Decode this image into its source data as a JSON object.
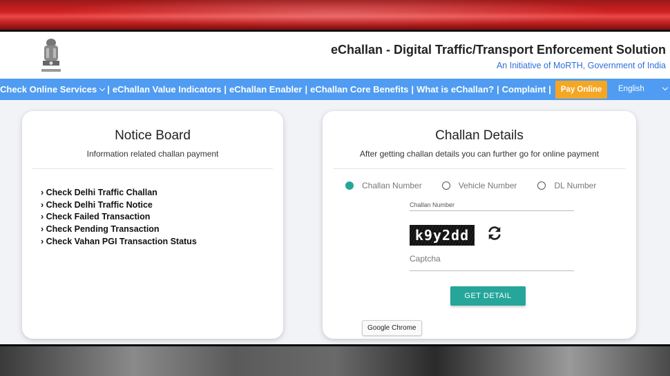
{
  "header": {
    "title": "eChallan - Digital Traffic/Transport Enforcement Solution",
    "subtitle": "An Initiative of MoRTH, Government of India"
  },
  "nav": {
    "check_online": "Check Online Services",
    "items": [
      "eChallan Value Indicators",
      "eChallan Enabler",
      "eChallan Core Benefits",
      "What is eChallan?",
      "Complaint"
    ],
    "pay_online": "Pay Online",
    "language": "English"
  },
  "notice_board": {
    "title": "Notice Board",
    "subtitle": "Information related challan payment",
    "links": [
      "Check Delhi Traffic Challan",
      "Check Delhi Traffic Notice",
      "Check Failed Transaction",
      "Check Pending Transaction",
      "Check Vahan PGI Transaction Status"
    ]
  },
  "challan_details": {
    "title": "Challan Details",
    "subtitle": "After getting challan details you can further go for online payment",
    "options": [
      "Challan Number",
      "Vehicle Number",
      "DL Number"
    ],
    "selected_option": "Challan Number",
    "field_label": "Challan Number",
    "captcha_text": "k9y2dd",
    "captcha_placeholder": "Captcha",
    "button": "GET DETAIL"
  },
  "tooltip": "Google Chrome",
  "colors": {
    "nav_bg": "#4f9cf2",
    "accent_teal": "#26a69a",
    "pay_button": "#f5a623",
    "link_blue": "#2f6fd6"
  }
}
